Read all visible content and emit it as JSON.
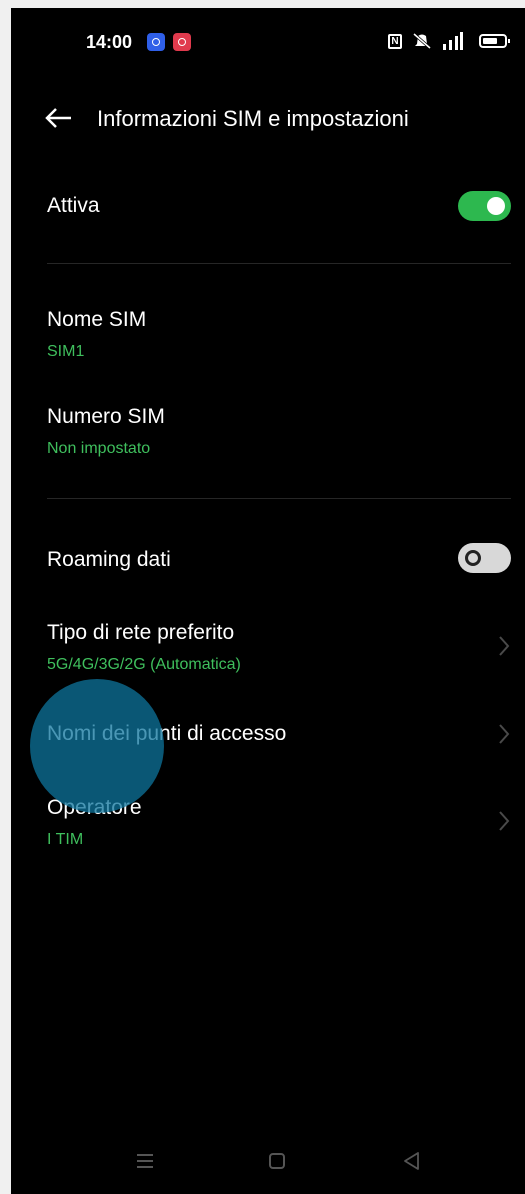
{
  "status_bar": {
    "time": "14:00",
    "icons": [
      "hotspot-app-icon",
      "screen-record-app-icon",
      "nfc-icon",
      "mute-icon",
      "signal-icon",
      "battery-icon"
    ]
  },
  "header": {
    "title": "Informazioni SIM e impostazioni",
    "back_icon": "arrow-left-icon"
  },
  "settings": {
    "active": {
      "label": "Attiva",
      "enabled": true
    },
    "sim_name": {
      "label": "Nome SIM",
      "value": "SIM1"
    },
    "sim_number": {
      "label": "Numero SIM",
      "value": "Non impostato"
    },
    "roaming": {
      "label": "Roaming dati",
      "enabled": false
    },
    "network_type": {
      "label": "Tipo di rete preferito",
      "value": "5G/4G/3G/2G (Automatica)"
    },
    "apn": {
      "label": "Nomi dei punti di accesso"
    },
    "operator": {
      "label": "Operatore",
      "value": "I TIM"
    }
  },
  "nav_bar": {
    "icons": [
      "menu-icon",
      "home-icon",
      "back-icon"
    ]
  },
  "colors": {
    "accent_green": "#2db84f",
    "subtitle_green": "#3fbf5d",
    "background": "#000000",
    "touch_indicator": "#0d749c"
  }
}
